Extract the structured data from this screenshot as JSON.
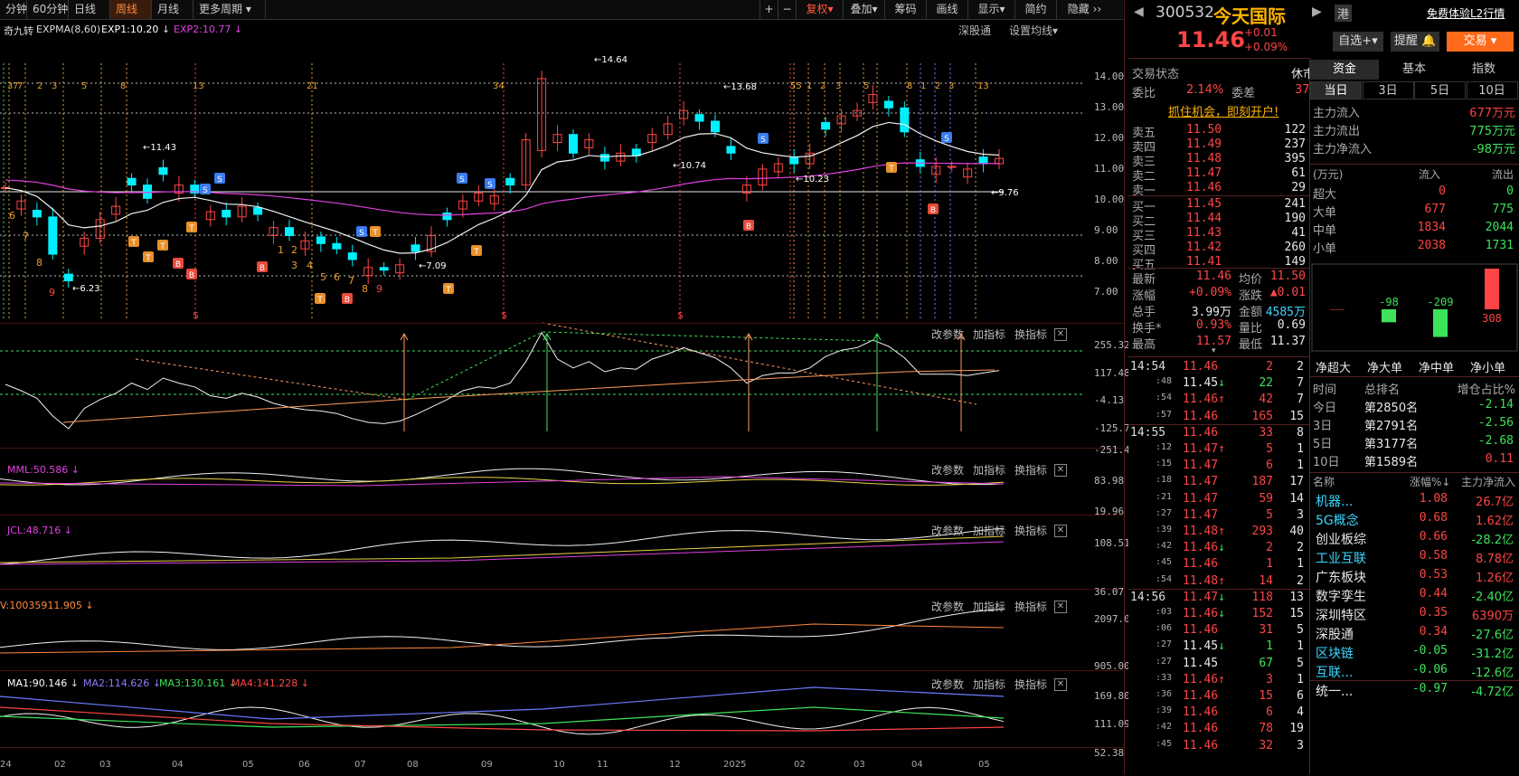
{
  "toolbar": {
    "periods": [
      "分钟",
      "60分钟",
      "日线",
      "周线",
      "月线",
      "更多周期"
    ],
    "active_period": "周线",
    "tools": [
      "+",
      "−",
      "复权",
      "叠加",
      "筹码",
      "画线",
      "显示",
      "简约",
      "隐藏"
    ]
  },
  "chart_header": {
    "indicator": "奇九转",
    "ema_label": "EXPMA(8,60)",
    "exp1": "EXP1:10.20",
    "exp2": "EXP2:10.77",
    "shengutong": "深股通",
    "set_ma": "设置均线"
  },
  "price_axis": [
    "14.00",
    "13.00",
    "12.00",
    "11.00",
    "10.00",
    "9.00",
    "8.00",
    "7.00"
  ],
  "price_annotations": [
    "14.64",
    "13.68",
    "11.43",
    "10.74",
    "10.23",
    "9.76",
    "7.09",
    "6.23"
  ],
  "sub_buttons": {
    "params": "改参数",
    "add": "加指标",
    "switch": "换指标",
    "close": "✕"
  },
  "panels": [
    {
      "title": "",
      "axis": [
        "255.32",
        "117.48",
        "-4.13",
        "-125.75",
        "-251.42"
      ]
    },
    {
      "title": "MML:50.586",
      "axis": [
        "83.98",
        "19.96"
      ]
    },
    {
      "title": "JCL:48.716",
      "axis": [
        "108.51",
        "36.07"
      ]
    },
    {
      "title": "V:10035911.905",
      "axis": [
        "2097.00",
        "905.00"
      ]
    },
    {
      "titles": [
        "MA1:90.146",
        "MA2:114.626",
        "MA3:130.161",
        "MA4:141.228"
      ],
      "axis": [
        "169.80",
        "111.09",
        "52.38"
      ]
    }
  ],
  "x_axis": [
    "24",
    "02",
    "03",
    "04",
    "05",
    "06",
    "07",
    "08",
    "09",
    "10",
    "11",
    "12",
    "2025",
    "02",
    "03",
    "04",
    "05"
  ],
  "stock": {
    "code": "300532",
    "name": "今天国际",
    "price": "11.46",
    "change": "+0.01",
    "change_pct": "+0.09%",
    "tag": "港",
    "promo": "免费体验L2行情",
    "btn_watch": "自选+",
    "btn_alert": "提醒",
    "btn_trade": "交易"
  },
  "status": {
    "label": "交易状态",
    "value": "休市",
    "weibi_label": "委比",
    "weibi": "2.14%",
    "weicha_label": "委差",
    "weicha": "37",
    "promo": "抓住机会，即刻开户!"
  },
  "asks": [
    {
      "label": "卖五",
      "price": "11.50",
      "vol": "122"
    },
    {
      "label": "卖四",
      "price": "11.49",
      "vol": "237"
    },
    {
      "label": "卖三",
      "price": "11.48",
      "vol": "395"
    },
    {
      "label": "卖二",
      "price": "11.47",
      "vol": "61"
    },
    {
      "label": "卖一",
      "price": "11.46",
      "vol": "29"
    }
  ],
  "bids": [
    {
      "label": "买一",
      "price": "11.45",
      "vol": "241"
    },
    {
      "label": "买二",
      "price": "11.44",
      "vol": "190"
    },
    {
      "label": "买三",
      "price": "11.43",
      "vol": "41"
    },
    {
      "label": "买四",
      "price": "11.42",
      "vol": "260"
    },
    {
      "label": "买五",
      "price": "11.41",
      "vol": "149"
    }
  ],
  "quote": [
    [
      "最新",
      "11.46",
      "均价",
      "11.50"
    ],
    [
      "涨幅",
      "+0.09%",
      "涨跌",
      "▲0.01"
    ],
    [
      "总手",
      "3.99万",
      "金额",
      "4585万"
    ],
    [
      "换手*",
      "0.93%",
      "量比",
      "0.69"
    ],
    [
      "最高",
      "11.57",
      "最低",
      "11.37"
    ]
  ],
  "ticks": [
    {
      "t": "14:54",
      "p": "11.46",
      "d": "",
      "v": "2",
      "n": "2",
      "c": "red"
    },
    {
      "t": ":48",
      "p": "11.45",
      "d": "↓",
      "v": "22",
      "n": "7",
      "c": "wht"
    },
    {
      "t": ":54",
      "p": "11.46",
      "d": "↑",
      "v": "42",
      "n": "7",
      "c": "red"
    },
    {
      "t": ":57",
      "p": "11.46",
      "d": "",
      "v": "165",
      "n": "15",
      "c": "red"
    },
    {
      "t": "14:55",
      "p": "11.46",
      "d": "",
      "v": "33",
      "n": "8",
      "c": "red"
    },
    {
      "t": ":12",
      "p": "11.47",
      "d": "↑",
      "v": "5",
      "n": "1",
      "c": "red"
    },
    {
      "t": ":15",
      "p": "11.47",
      "d": "",
      "v": "6",
      "n": "1",
      "c": "red"
    },
    {
      "t": ":18",
      "p": "11.47",
      "d": "",
      "v": "187",
      "n": "17",
      "c": "red"
    },
    {
      "t": ":21",
      "p": "11.47",
      "d": "",
      "v": "59",
      "n": "14",
      "c": "red"
    },
    {
      "t": ":27",
      "p": "11.47",
      "d": "",
      "v": "5",
      "n": "3",
      "c": "red"
    },
    {
      "t": ":39",
      "p": "11.48",
      "d": "↑",
      "v": "293",
      "n": "40",
      "c": "red"
    },
    {
      "t": ":42",
      "p": "11.46",
      "d": "↓",
      "v": "2",
      "n": "2",
      "c": "red"
    },
    {
      "t": ":45",
      "p": "11.46",
      "d": "",
      "v": "1",
      "n": "1",
      "c": "red"
    },
    {
      "t": ":54",
      "p": "11.48",
      "d": "↑",
      "v": "14",
      "n": "2",
      "c": "red"
    },
    {
      "t": "14:56",
      "p": "11.47",
      "d": "↓",
      "v": "118",
      "n": "13",
      "c": "red"
    },
    {
      "t": ":03",
      "p": "11.46",
      "d": "↓",
      "v": "152",
      "n": "15",
      "c": "red"
    },
    {
      "t": ":06",
      "p": "11.46",
      "d": "",
      "v": "31",
      "n": "5",
      "c": "red"
    },
    {
      "t": ":27",
      "p": "11.45",
      "d": "↓",
      "v": "1",
      "n": "1",
      "c": "wht"
    },
    {
      "t": ":27",
      "p": "11.45",
      "d": "",
      "v": "67",
      "n": "5",
      "c": "wht"
    },
    {
      "t": ":33",
      "p": "11.46",
      "d": "↑",
      "v": "3",
      "n": "1",
      "c": "red"
    },
    {
      "t": ":36",
      "p": "11.46",
      "d": "",
      "v": "15",
      "n": "6",
      "c": "red"
    },
    {
      "t": ":39",
      "p": "11.46",
      "d": "",
      "v": "6",
      "n": "4",
      "c": "red"
    },
    {
      "t": ":42",
      "p": "11.46",
      "d": "",
      "v": "78",
      "n": "19",
      "c": "red"
    },
    {
      "t": ":45",
      "p": "11.46",
      "d": "",
      "v": "32",
      "n": "3",
      "c": "red"
    }
  ],
  "fund_tabs": [
    "资金",
    "基本",
    "指数"
  ],
  "period_tabs": [
    "当日",
    "3日",
    "5日",
    "10日"
  ],
  "flow": [
    {
      "label": "主力流入",
      "value": "677万元",
      "c": "red"
    },
    {
      "label": "主力流出",
      "value": "775万元",
      "c": "grn"
    },
    {
      "label": "主力净流入",
      "value": "-98万元",
      "c": "grn"
    }
  ],
  "flow_table_header": [
    "(万元)",
    "流入",
    "流出"
  ],
  "flow_table": [
    {
      "label": "超大",
      "in": "0",
      "out": "0"
    },
    {
      "label": "大单",
      "in": "677",
      "out": "775"
    },
    {
      "label": "中单",
      "in": "1834",
      "out": "2044"
    },
    {
      "label": "小单",
      "in": "2038",
      "out": "1731"
    }
  ],
  "net_bars": {
    "labels": [
      "净超大",
      "净大单",
      "净中单",
      "净小单"
    ],
    "values": [
      0,
      -98,
      -209,
      308
    ]
  },
  "rank_header": [
    "时间",
    "总排名",
    "增仓占比%"
  ],
  "rank": [
    {
      "t": "今日",
      "r": "第2850名",
      "v": "-2.14",
      "c": "grn"
    },
    {
      "t": "3日",
      "r": "第2791名",
      "v": "-2.56",
      "c": "grn"
    },
    {
      "t": "5日",
      "r": "第3177名",
      "v": "-2.68",
      "c": "grn"
    },
    {
      "t": "10日",
      "r": "第1589名",
      "v": "0.11",
      "c": "red"
    }
  ],
  "sector_header": [
    "名称",
    "涨幅%↓",
    "主力净流入"
  ],
  "sectors": [
    {
      "n": "机器...",
      "p": "1.08",
      "f": "26.7亿",
      "nc": "cyan",
      "fc": "red"
    },
    {
      "n": "5G概念",
      "p": "0.68",
      "f": "1.62亿",
      "nc": "cyan",
      "fc": "red"
    },
    {
      "n": "创业板综",
      "p": "0.66",
      "f": "-28.2亿",
      "nc": "wht",
      "fc": "grn"
    },
    {
      "n": "工业互联",
      "p": "0.58",
      "f": "8.78亿",
      "nc": "cyan",
      "fc": "red"
    },
    {
      "n": "广东板块",
      "p": "0.53",
      "f": "1.26亿",
      "nc": "wht",
      "fc": "red"
    },
    {
      "n": "数字孪生",
      "p": "0.44",
      "f": "-2.40亿",
      "nc": "wht",
      "fc": "grn"
    },
    {
      "n": "深圳特区",
      "p": "0.35",
      "f": "6390万",
      "nc": "wht",
      "fc": "red"
    },
    {
      "n": "深股通",
      "p": "0.34",
      "f": "-27.6亿",
      "nc": "wht",
      "fc": "grn"
    },
    {
      "n": "区块链",
      "p": "-0.05",
      "f": "-31.2亿",
      "nc": "cyan",
      "fc": "grn"
    },
    {
      "n": "互联...",
      "p": "-0.06",
      "f": "-12.6亿",
      "nc": "cyan",
      "fc": "grn"
    },
    {
      "n": "统一...",
      "p": "-0.97",
      "f": "-4.72亿",
      "nc": "wht",
      "fc": "grn"
    }
  ],
  "chart_data": {
    "type": "line",
    "series": [
      {
        "values": [
          10.5,
          10.0,
          9.4,
          8.0,
          7.0,
          8.6,
          9.3,
          9.8,
          10.6,
          10.1,
          11.0,
          10.6,
          10.3,
          9.6,
          9.4,
          9.8,
          9.5,
          9.0,
          8.7,
          8.5,
          8.4,
          8.2,
          7.8,
          7.5,
          7.4,
          7.6,
          8.1,
          8.7,
          9.3,
          10.0,
          10.3,
          10.2,
          10.6,
          12.3,
          14.6,
          12.5,
          11.8,
          12.3,
          11.5,
          11.8,
          11.7,
          12.5,
          12.9,
          13.4,
          13.0,
          12.6,
          11.8,
          10.6,
          11.2,
          11.4,
          11.4,
          11.8,
          12.7,
          13.2,
          13.4,
          14.0,
          13.5,
          12.6,
          11.3,
          11.3,
          11.3,
          11.2,
          11.4,
          11.6
        ]
      }
    ]
  },
  "colors": {
    "up": "#ff4545",
    "down": "#00f0ff",
    "bg": "#000000",
    "accent": "#ff8a3c"
  }
}
